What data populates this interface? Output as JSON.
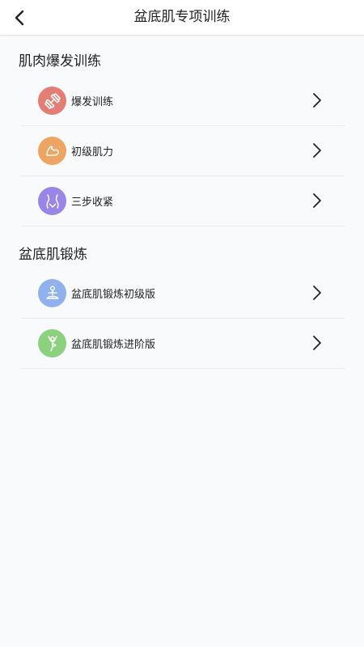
{
  "header": {
    "title": "盆底肌专项训练"
  },
  "sections": [
    {
      "title": "肌肉爆发训练",
      "items": [
        {
          "label": "爆发训练",
          "icon": "dumbbell-icon",
          "color": "#e47d74"
        },
        {
          "label": "初级肌力",
          "icon": "muscle-arm-icon",
          "color": "#eea563"
        },
        {
          "label": "三步收紧",
          "icon": "waist-icon",
          "color": "#9a85e9"
        }
      ]
    },
    {
      "title": "盆底肌锻炼",
      "items": [
        {
          "label": "盆底肌锻炼初级版",
          "icon": "meditation-icon",
          "color": "#8fb2ef"
        },
        {
          "label": "盆底肌锻炼进阶版",
          "icon": "yoga-pose-icon",
          "color": "#8cd17d"
        }
      ]
    }
  ]
}
